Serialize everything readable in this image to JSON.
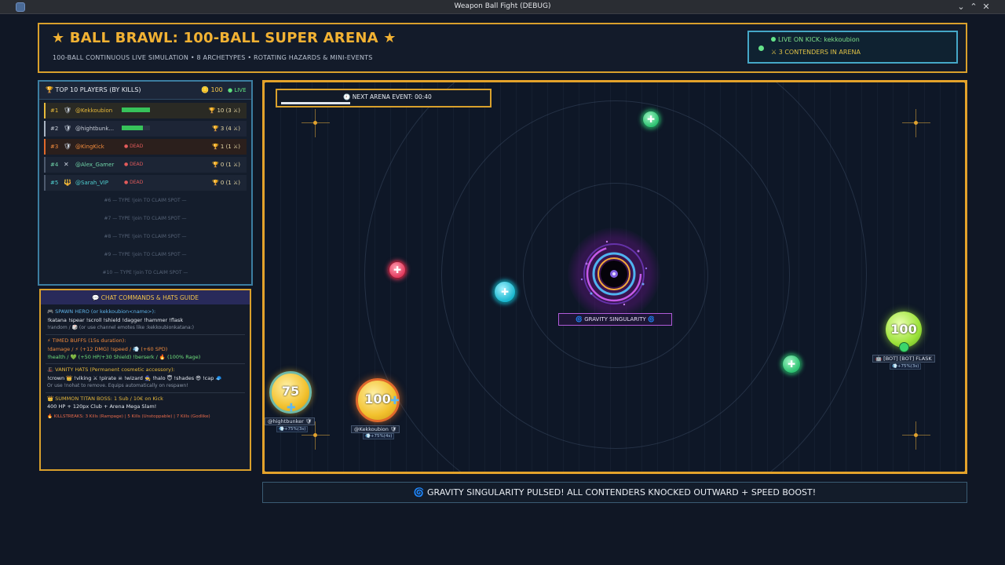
{
  "window": {
    "title": "Weapon Ball Fight (DEBUG)",
    "controls": [
      "⌄",
      "⌃",
      "✕"
    ]
  },
  "header": {
    "title": "★ BALL BRAWL: 100-BALL SUPER ARENA ★",
    "subtitle": "100-BALL CONTINUOUS LIVE SIMULATION • 8 ARCHETYPES • ROTATING HAZARDS & MINI-EVENTS",
    "live_on_kick": "LIVE ON KICK: kekkoubion",
    "contenders": "⚔ 3 CONTENDERS IN ARENA"
  },
  "leaderboard": {
    "title": "🏆 TOP 10 PLAYERS (BY KILLS)",
    "count": "🪙 100",
    "live": "● LIVE",
    "rows": [
      {
        "rank": "#1",
        "icon": "🛡",
        "name": "@Kekkoubion",
        "status": "alive",
        "hp": 1.0,
        "kills": "🏆 10 (3 ⚔)",
        "color": "#e7b93a",
        "bg": "#2a2a24",
        "border": "#e7b93a"
      },
      {
        "rank": "#2",
        "icon": "🛡",
        "name": "@hightbunk...",
        "status": "alive",
        "hp": 0.75,
        "kills": "🏆 3 (4 ⚔)",
        "color": "#c6ccd6",
        "bg": "#1d2536",
        "border": "#a9b3c2"
      },
      {
        "rank": "#3",
        "icon": "🛡",
        "name": "@KingKick",
        "status": "dead",
        "dead_label": "● DEAD",
        "kills": "🏆 1 (1 ⚔)",
        "color": "#f08a3c",
        "bg": "#2b1f1c",
        "border": "#e0692b"
      },
      {
        "rank": "#4",
        "icon": "✕",
        "name": "@Alex_Gamer",
        "status": "dead",
        "dead_label": "● DEAD",
        "kills": "🏆 0 (1 ⚔)",
        "color": "#6fd3a8",
        "bg": "#1c2535",
        "border": "#4e5a6e"
      },
      {
        "rank": "#5",
        "icon": "🔱",
        "name": "@Sarah_VIP",
        "status": "dead",
        "dead_label": "● DEAD",
        "kills": "🏆 0 (1 ⚔)",
        "color": "#4fcfd0",
        "bg": "#1c2535",
        "border": "#4e5a6e"
      }
    ],
    "empty_slots": [
      "#6 — TYPE !join TO CLAIM SPOT —",
      "#7 — TYPE !join TO CLAIM SPOT —",
      "#8 — TYPE !join TO CLAIM SPOT —",
      "#9 — TYPE !join TO CLAIM SPOT —",
      "#10 — TYPE !join TO CLAIM SPOT —"
    ]
  },
  "guide": {
    "title": "💬 CHAT COMMANDS & HATS GUIDE",
    "spawn_head": "🎮 SPAWN HERO (or kekkoubion<name>):",
    "spawn_cmds": "!katana !spear !scroll !shield !dagger !hammer !flask",
    "spawn_note": "!random / 🎲 (or use channel emotes like :kekkoubionkatana:)",
    "buffs_head": "⚡ TIMED BUFFS (15s duration):",
    "buffs_line1": "!damage / ⚡ (+12 DMG)     !speed / 💨 (+60 SPD)",
    "buffs_line2": "!health / 💚 (+50 HP/+30 Shield)  !berserk / 🔥 (100% Rage)",
    "hats_head": "🎩 VANITY HATS (Permanent cosmetic accessory):",
    "hats_cmds": "!crown 👑 !viking ⚔ !pirate ☠ !wizard 🧙 !halo 😇 !shades 😎 !cap 🧢",
    "hats_note": "Or use !nohat to remove. Equips automatically on respawn!",
    "titan_head": "👑 SUMMON TITAN BOSS: 1 Sub / 10€ on Kick",
    "titan_desc": "400 HP + 120px Club + Arena Mega Slam!",
    "killstreaks": "🔥 KILLSTREAKS: 3 Kills (Rampage) | 5 Kills (Unstoppable) | 7 Kills (Godlike)"
  },
  "arena": {
    "event": "🕘 NEXT ARENA EVENT: 00:40",
    "event_progress": 0.32,
    "singularity_label": "🌀 GRAVITY SINGULARITY 🌀",
    "balls": [
      {
        "name": "@hightbunker 🛡",
        "hp": "75",
        "sub": "💨+75%(3s)",
        "color": "#f2c12e"
      },
      {
        "name": "@Kekkoubion 🛡",
        "hp": "100",
        "sub": "💨+75%(4s)",
        "color": "#f2c12e"
      },
      {
        "name": "🤖 [BOT] [BOT] FLASK",
        "hp": "100",
        "sub": "💨+75%(3s)",
        "color": "#9de33b"
      }
    ]
  },
  "banner": "🌀 GRAVITY SINGULARITY PULSED! ALL CONTENDERS KNOCKED OUTWARD + SPEED BOOST!"
}
